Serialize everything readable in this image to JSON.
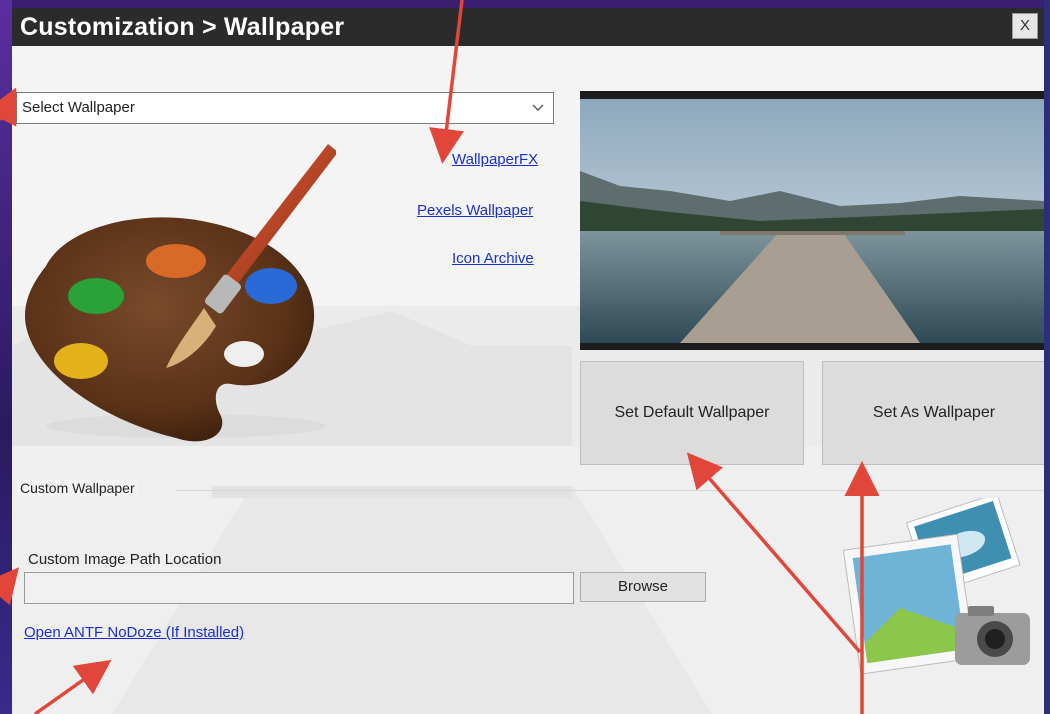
{
  "window": {
    "title": "Customization > Wallpaper",
    "close_label": "X"
  },
  "wallpaper_select": {
    "selected": "Select Wallpaper"
  },
  "links": {
    "wallpaperfx": "WallpaperFX",
    "pexels": "Pexels Wallpaper",
    "icon_archive": "Icon Archive"
  },
  "buttons": {
    "set_default": "Set Default Wallpaper",
    "set_as": "Set As Wallpaper",
    "browse": "Browse"
  },
  "custom": {
    "group_label": "Custom Wallpaper",
    "path_label": "Custom Image Path Location",
    "path_value": "",
    "nodoze_link": "Open ANTF NoDoze (If Installed)"
  },
  "colors": {
    "titlebar": "#2b2b2b",
    "link": "#1a2fd1",
    "arrow": "#e0463a",
    "button": "#dcdcdc"
  },
  "icons": {
    "palette": "paint-palette-icon",
    "photos": "photos-camera-icon",
    "chevron": "chevron-down-icon"
  }
}
